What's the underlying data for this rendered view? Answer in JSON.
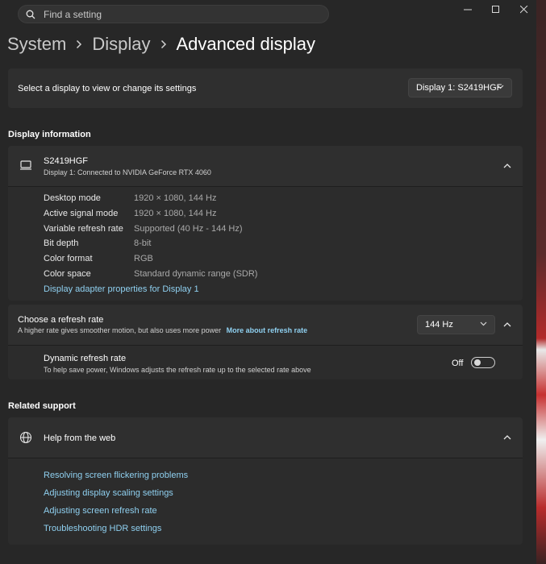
{
  "search": {
    "placeholder": "Find a setting"
  },
  "breadcrumb": {
    "level1": "System",
    "level2": "Display",
    "current": "Advanced display"
  },
  "display_select": {
    "label": "Select a display to view or change its settings",
    "value": "Display 1: S2419HGF"
  },
  "display_information": {
    "heading": "Display information",
    "monitor_name": "S2419HGF",
    "monitor_subtitle": "Display 1: Connected to NVIDIA GeForce RTX 4060",
    "rows": [
      {
        "key": "Desktop mode",
        "value": "1920 × 1080, 144 Hz"
      },
      {
        "key": "Active signal mode",
        "value": "1920 × 1080, 144 Hz"
      },
      {
        "key": "Variable refresh rate",
        "value": "Supported (40 Hz - 144 Hz)"
      },
      {
        "key": "Bit depth",
        "value": "8-bit"
      },
      {
        "key": "Color format",
        "value": "RGB"
      },
      {
        "key": "Color space",
        "value": "Standard dynamic range (SDR)"
      }
    ],
    "adapter_link": "Display adapter properties for Display 1"
  },
  "refresh_rate": {
    "title": "Choose a refresh rate",
    "subtitle": "A higher rate gives smoother motion, but also uses more power",
    "more_link": "More about refresh rate",
    "value": "144 Hz",
    "dynamic_title": "Dynamic refresh rate",
    "dynamic_subtitle": "To help save power, Windows adjusts the refresh rate up to the selected rate above",
    "dynamic_state": "Off"
  },
  "related_support": {
    "heading": "Related support",
    "help_title": "Help from the web",
    "links": [
      "Resolving screen flickering problems",
      "Adjusting display scaling settings",
      "Adjusting screen refresh rate",
      "Troubleshooting HDR settings"
    ]
  },
  "icons": {
    "search": "search-icon",
    "monitor": "monitor-icon",
    "globe": "globe-icon",
    "chevron": "chevron-icon"
  },
  "colors": {
    "background": "#272727",
    "card": "#2f2f2f",
    "link": "#8fd0f0"
  }
}
